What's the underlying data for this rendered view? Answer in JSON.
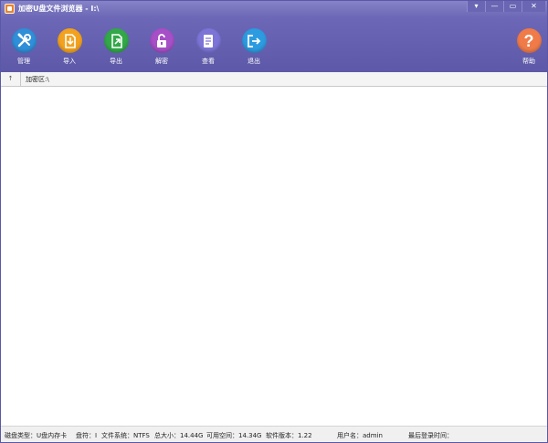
{
  "window": {
    "title": "加密U盘文件浏览器 - I:\\",
    "controls": {
      "menu": "▾",
      "minimize": "—",
      "maximize": "▭",
      "close": "✕"
    }
  },
  "toolbar": {
    "items": [
      {
        "label": "管理",
        "icon": "wrench-screwdriver-icon",
        "color": "#2f8fd8"
      },
      {
        "label": "导入",
        "icon": "import-file-icon",
        "color": "#f2a21e"
      },
      {
        "label": "导出",
        "icon": "export-file-icon",
        "color": "#32a848"
      },
      {
        "label": "解密",
        "icon": "unlock-icon",
        "color": "#a64fc7"
      },
      {
        "label": "查看",
        "icon": "document-view-icon",
        "color": "#7c74d6"
      },
      {
        "label": "退出",
        "icon": "exit-icon",
        "color": "#2d9be0"
      }
    ],
    "help": {
      "label": "帮助",
      "icon": "question-icon",
      "color": "#f07b48"
    }
  },
  "path": {
    "up": "↑",
    "current": "加密区:\\"
  },
  "status": {
    "disk_type": "磁盘类型：U盘内存卡",
    "drive": "盘符：I",
    "filesystem": "文件系统：NTFS",
    "total": "总大小：14.44G",
    "free": "可用空间：14.34G",
    "version": "软件版本：1.22",
    "user": "用户名：admin",
    "last_login": "最后登录时间："
  }
}
